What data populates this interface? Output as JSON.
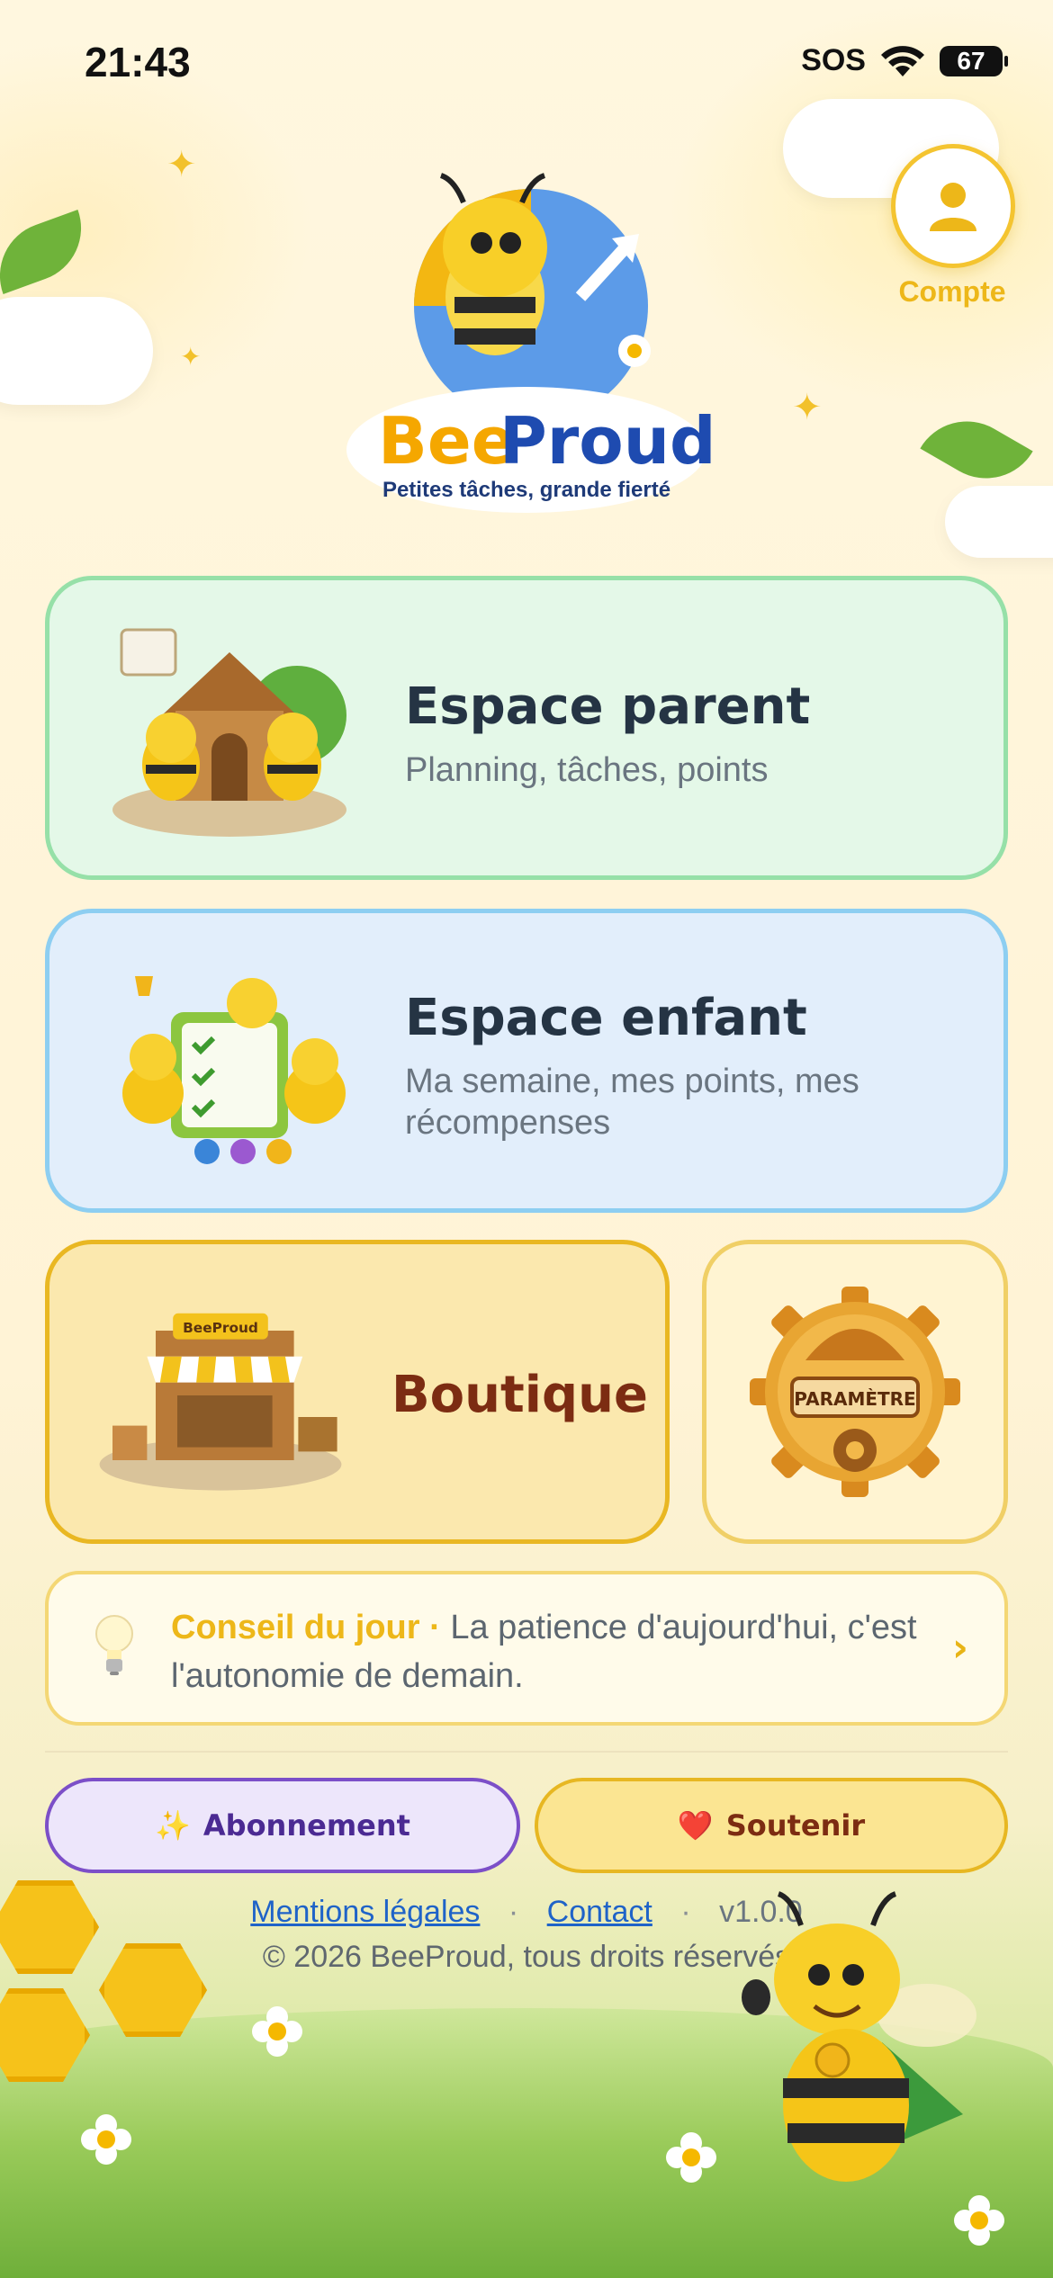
{
  "status_bar": {
    "time": "21:43",
    "network": "SOS",
    "battery": "67"
  },
  "account": {
    "label": "Compte",
    "icon": "person-icon"
  },
  "logo": {
    "brand_bee": "Bee",
    "brand_proud": "Proud",
    "tagline": "Petites tâches, grande fierté"
  },
  "cards": {
    "parent": {
      "title": "Espace parent",
      "subtitle": "Planning, tâches, points"
    },
    "enfant": {
      "title": "Espace enfant",
      "subtitle": "Ma semaine, mes points, mes récompenses"
    },
    "boutique": {
      "title": "Boutique",
      "sign": "BeeProud"
    },
    "settings": {
      "label": "PARAMÈTRE"
    }
  },
  "tip": {
    "title": "Conseil du jour",
    "separator": "·",
    "text": "La patience d'aujourd'hui, c'est l'autonomie de demain.",
    "chevron": "›"
  },
  "buttons": {
    "subscription": {
      "emoji": "✨",
      "label": "Abonnement"
    },
    "support": {
      "emoji": "❤️",
      "label": "Soutenir"
    }
  },
  "footer": {
    "legal": "Mentions légales",
    "contact": "Contact",
    "separator": "·",
    "version": "v1.0.0",
    "copyright": "© 2026 BeeProud, tous droits réservés"
  },
  "colors": {
    "accent_gold": "#EDB719",
    "title_dark": "#253444",
    "boutique_text": "#7C2C12",
    "parent_bg": "#E4F8E8",
    "enfant_bg": "#E2EEFB",
    "boutique_bg": "#FBE8AE",
    "link_blue": "#1F63C8"
  }
}
